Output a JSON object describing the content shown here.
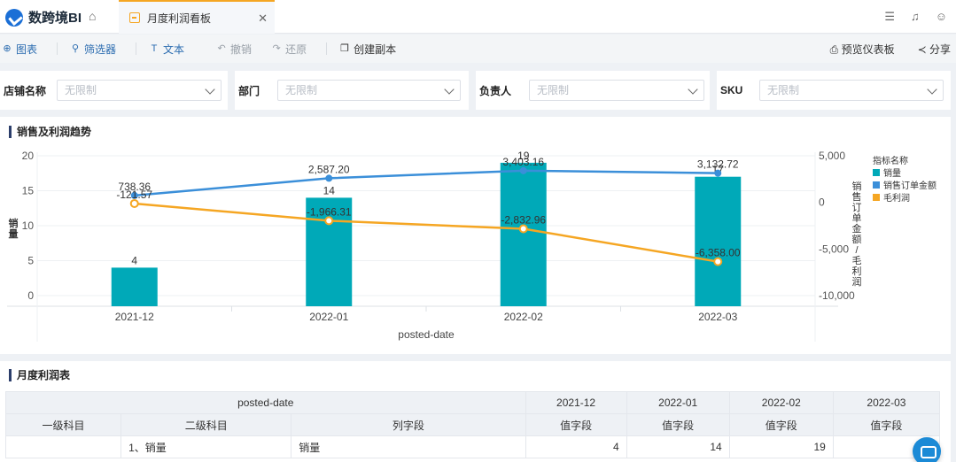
{
  "app": {
    "name": "数跨境BI"
  },
  "tab": {
    "label": "月度利润看板"
  },
  "toolbar": {
    "chart": "图表",
    "filter": "筛选器",
    "text": "文本",
    "undo": "撤销",
    "redo": "还原",
    "copy": "创建副本",
    "preview": "预览仪表板",
    "share": "分享"
  },
  "filters": [
    {
      "label": "店铺名称",
      "placeholder": "无限制"
    },
    {
      "label": "部门",
      "placeholder": "无限制"
    },
    {
      "label": "负责人",
      "placeholder": "无限制"
    },
    {
      "label": "SKU",
      "placeholder": "无限制"
    }
  ],
  "chart_section": {
    "title": "销售及利润趋势"
  },
  "chart_data": {
    "type": "bar",
    "categories": [
      "2021-12",
      "2022-01",
      "2022-02",
      "2022-03"
    ],
    "xlabel": "posted-date",
    "ylabel": "销量",
    "y2label": "销售订单金额/毛利润",
    "ylim": [
      0,
      20
    ],
    "y_ticks": [
      "20",
      "15",
      "10",
      "5",
      "0"
    ],
    "y2lim": [
      -10000,
      5000
    ],
    "y2_ticks": [
      "5,000",
      "0",
      "-5,000",
      "-10,000"
    ],
    "legend_title": "指标名称",
    "series": [
      {
        "name": "销量",
        "type": "bar",
        "axis": "left",
        "values": [
          4,
          14,
          19,
          17
        ],
        "labels": [
          "4",
          "14",
          "19",
          "17"
        ],
        "color": "#00a9b8"
      },
      {
        "name": "销售订单金额",
        "type": "line",
        "axis": "right",
        "values": [
          738.36,
          2587.2,
          3403.16,
          3132.72
        ],
        "labels": [
          "738.36",
          "2,587.20",
          "3,403.16",
          "3,132.72"
        ],
        "color": "#3b8fd9"
      },
      {
        "name": "毛利润",
        "type": "line",
        "axis": "right",
        "values": [
          -121.57,
          -1966.31,
          -2832.96,
          -6358.0
        ],
        "labels": [
          "-121.57",
          "-1,966.31",
          "-2,832.96",
          "-6,358.00"
        ],
        "color": "#f5a623"
      }
    ],
    "grid": true,
    "legend_position": "right"
  },
  "table_section": {
    "title": "月度利润表"
  },
  "table": {
    "top_header": "posted-date",
    "months": [
      "2021-12",
      "2022-01",
      "2022-02",
      "2022-03"
    ],
    "col_headers": [
      "一级科目",
      "二级科目",
      "列字段"
    ],
    "value_header": "值字段",
    "rows": [
      {
        "level1": "",
        "level2": "1、销量",
        "field": "销量",
        "values": [
          "4",
          "14",
          "19",
          ""
        ]
      }
    ]
  }
}
